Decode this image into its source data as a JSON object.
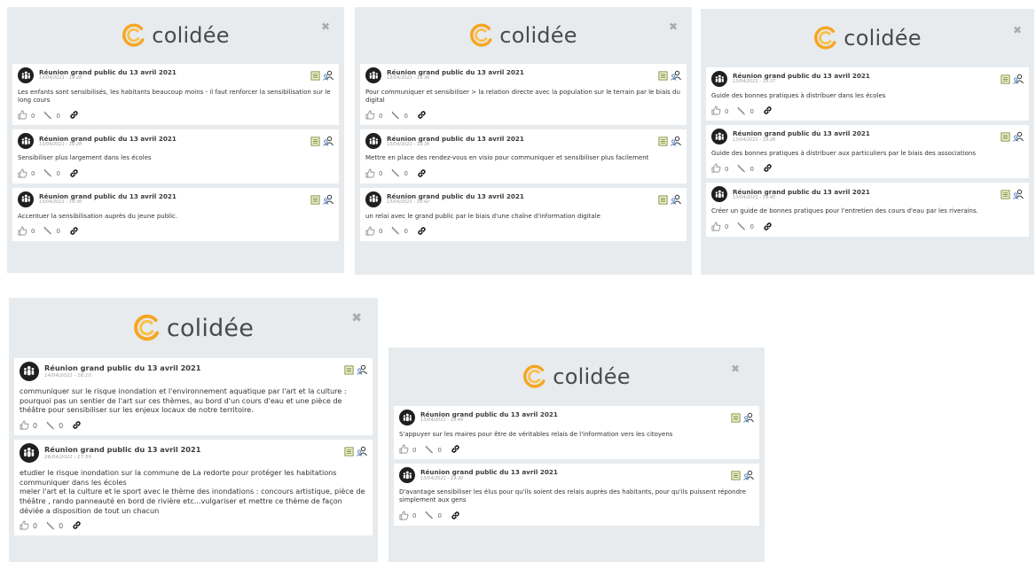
{
  "brand": {
    "name": "colidée",
    "accent": "#f5a623",
    "accent_light": "#f9c04d"
  },
  "icons": {
    "close": "close-icon",
    "notes": "notes-icon",
    "users": "users-icon",
    "like": "thumbs-up-icon",
    "comment": "pencil-icon",
    "link": "link-icon"
  },
  "close_glyph": "✖",
  "panels": [
    {
      "cards": [
        {
          "title": "Réunion grand public du 13 avril 2021",
          "date": "13/04/2021 - 19:28",
          "body": "Les enfants sont sensibilisés, les habitants beaucoup moins - il faut renforcer la sensibilisation sur le long cours",
          "likes": "0",
          "comments": "0"
        },
        {
          "title": "Réunion grand public du 13 avril 2021",
          "date": "13/04/2021 - 19:28",
          "body": "Sensibiliser plus largement dans les écoles",
          "likes": "0",
          "comments": "0"
        },
        {
          "title": "Réunion grand public du 13 avril 2021",
          "date": "13/04/2021 - 19:36",
          "body": "Accentuer la sensibilisation auprès du jeune public.",
          "likes": "0",
          "comments": "0"
        }
      ]
    },
    {
      "cards": [
        {
          "title": "Réunion grand public du 13 avril 2021",
          "date": "13/04/2021 - 19:36",
          "body": "Pour communiquer et sensibiliser > la relation directe avec la population sur le terrain par le biais du digital",
          "likes": "0",
          "comments": "0"
        },
        {
          "title": "Réunion grand public du 13 avril 2021",
          "date": "13/04/2021 - 19:36",
          "body": "Mettre en place des rendez-vous en visio pour communiquer et sensibiliser plus facilement",
          "likes": "0",
          "comments": "0"
        },
        {
          "title": "Réunion grand public du 13 avril 2021",
          "date": "13/04/2021 - 19:42",
          "body": "un relai avec le grand public par le biais d'une chaîne d'information digitale",
          "likes": "0",
          "comments": "0"
        }
      ]
    },
    {
      "cards": [
        {
          "title": "Réunion grand public du 13 avril 2021",
          "date": "13/04/2021 - 19:37",
          "body": "Guide des bonnes pratiques à distribuer dans les écoles",
          "likes": "0",
          "comments": "0"
        },
        {
          "title": "Réunion grand public du 13 avril 2021",
          "date": "13/04/2021 - 19:26",
          "body": "Guide des bonnes pratiques à distribuer aux particuliers par le biais des associations",
          "likes": "0",
          "comments": "0"
        },
        {
          "title": "Réunion grand public du 13 avril 2021",
          "date": "13/04/2021 - 19:40",
          "body": "Créer un guide de bonnes pratiques pour l'entretien des cours d'eau par les riverains.",
          "likes": "0",
          "comments": "0"
        }
      ]
    },
    {
      "cards": [
        {
          "title": "Réunion grand public du 13 avril 2021",
          "date": "14/04/2021 - 16:10",
          "body": "communiquer sur le risque inondation et l'environnement aquatique par l'art et la culture :\npourquoi pas un sentier de l'art sur ces thèmes, au bord d'un cours d'eau et une pièce de théâtre pour sensibiliser sur les enjeux locaux de notre territoire.",
          "likes": "0",
          "comments": "0"
        },
        {
          "title": "Réunion grand public du 13 avril 2021",
          "date": "26/04/2021 - 17:59",
          "body": "etudier le risque inondation sur la commune de La redorte pour protéger les habitations\ncommuniquer dans les écoles\nmeler l'art et la culture et le sport avec le thème des inondations : concours artistique, pièce de théâtre , rando panneauté en bord de rivière etc...vulgariser et mettre ce thème de façon déviée a disposition de tout un chacun",
          "likes": "0",
          "comments": "0"
        }
      ]
    },
    {
      "cards": [
        {
          "title": "Réunion grand public du 13 avril 2021",
          "date": "13/04/2021 - 19:49",
          "body": "S'appuyer sur les maires pour être de véritables relais de l'information vers les citoyens",
          "likes": "0",
          "comments": "0"
        },
        {
          "title": "Réunion grand public du 13 avril 2021",
          "date": "13/04/2021 - 19:30",
          "body": "D'avantage sensibiliser les élus pour qu'ils soient des relais auprès des habitants, pour qu'ils puissent répondre simplement aux gens",
          "likes": "0",
          "comments": "0"
        }
      ]
    }
  ]
}
